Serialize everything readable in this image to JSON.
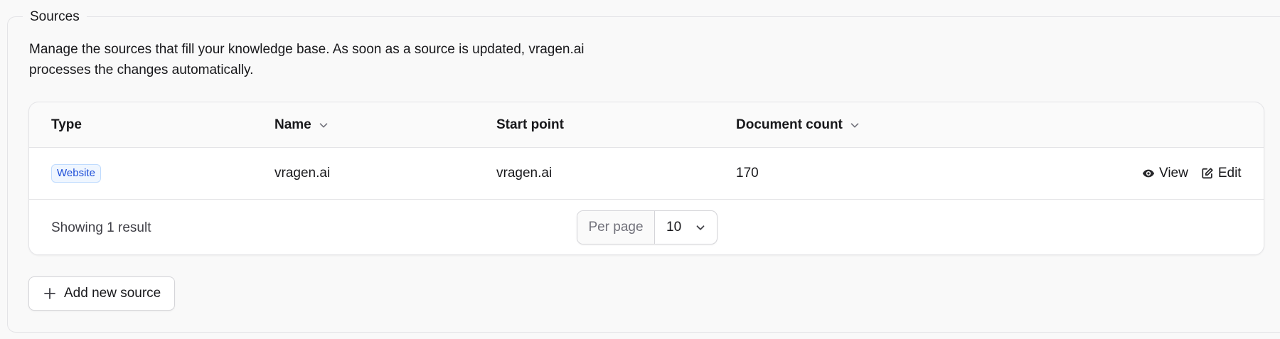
{
  "section": {
    "title": "Sources",
    "description": "Manage the sources that fill your knowledge base. As soon as a source is updated, vragen.ai processes the changes automatically."
  },
  "table": {
    "columns": {
      "type": "Type",
      "name": "Name",
      "start_point": "Start point",
      "document_count": "Document count"
    },
    "rows": [
      {
        "type": "Website",
        "name": "vragen.ai",
        "start_point": "vragen.ai",
        "document_count": "170",
        "view_label": "View",
        "edit_label": "Edit"
      }
    ],
    "footer": {
      "showing": "Showing 1 result",
      "per_page_label": "Per page",
      "per_page_value": "10"
    }
  },
  "actions": {
    "add_label": "Add new source"
  },
  "icons": {
    "sort_name": "chevron-down-icon",
    "sort_count": "chevron-down-icon",
    "view": "eye-icon",
    "edit": "edit-icon",
    "per_page": "chevron-down-icon",
    "add": "plus-icon"
  },
  "colors": {
    "badge_text": "#1d4ed8",
    "badge_bg": "#eff6ff",
    "badge_border": "#bfdbfe"
  }
}
